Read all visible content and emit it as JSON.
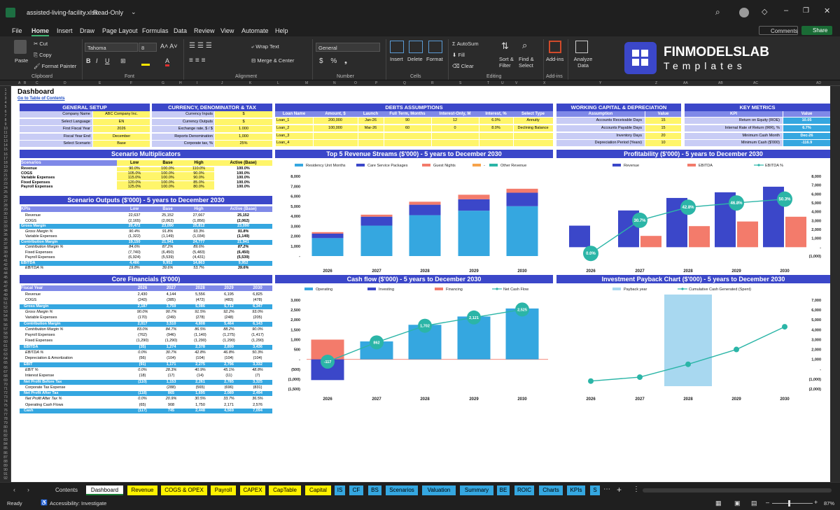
{
  "window": {
    "filename": "assisted-living-facility.xlsx",
    "mode": "Read-Only"
  },
  "menu": [
    "File",
    "Home",
    "Insert",
    "Draw",
    "Page Layout",
    "Formulas",
    "Data",
    "Review",
    "View",
    "Automate",
    "Help"
  ],
  "actions": {
    "comments": "Comments",
    "share": "Share"
  },
  "ribbon": {
    "paste": "Paste",
    "cut": "Cut",
    "copy": "Copy",
    "format_painter": "Format Painter",
    "clipboard": "Clipboard",
    "font_name": "Tahoma",
    "font_size": "8",
    "font": "Font",
    "wrap": "Wrap Text",
    "merge": "Merge & Center",
    "alignment": "Alignment",
    "number_format": "General",
    "number": "Number",
    "insert": "Insert",
    "delete": "Delete",
    "format": "Format",
    "cells": "Cells",
    "autosum": "AutoSum",
    "fill": "Fill",
    "clear": "Clear",
    "sort": "Sort & Filter",
    "find": "Find & Select",
    "editing": "Editing",
    "addins": "Add-ins",
    "analyze": "Analyze Data",
    "addins_group": "Add-ins",
    "brand1": "FINMODELSLAB",
    "brand2": "Templates"
  },
  "columns": [
    "A",
    "B",
    "C",
    "D",
    "E",
    "F",
    "G",
    "H",
    "I",
    "J",
    "K",
    "L",
    "M",
    "N",
    "O",
    "P",
    "Q",
    "R",
    "S",
    "T",
    "U",
    "V",
    "X",
    "Y",
    "Z",
    "AA",
    "AB",
    "AC",
    "AD"
  ],
  "dashboard": {
    "title": "Dashboard",
    "link": "Go to Table of Contents"
  },
  "general": {
    "title": "GENERAL SETUP",
    "rows": [
      [
        "Company Name",
        "ABC Company Inc."
      ],
      [
        "Select Language",
        "EN"
      ],
      [
        "First Fiscal Year",
        "2026"
      ],
      [
        "Fiscal Year End",
        "December"
      ],
      [
        "Select Scenario",
        "Base"
      ]
    ]
  },
  "currency": {
    "title": "CURRENCY, DENOMINATOR & TAX",
    "rows": [
      [
        "Currency Inputs",
        "$"
      ],
      [
        "Currency Outputs",
        "$"
      ],
      [
        "Exchange rate, $ / $",
        "1.000"
      ],
      [
        "Reports Denomination",
        "1,000"
      ],
      [
        "Corporate tax, %",
        "25%"
      ]
    ]
  },
  "debts": {
    "title": "DEBTS ASSUMPTIONS",
    "headers": [
      "Loan Name",
      "Amount, $",
      "Launch",
      "Full Term, Months",
      "Interest-Only, M",
      "Interest, %",
      "Select Type"
    ],
    "rows": [
      [
        "Loan_1",
        "200,000",
        "Jan-26",
        "90",
        "12",
        "6.0%",
        "Annuity"
      ],
      [
        "Loan_2",
        "100,000",
        "Mar-26",
        "60",
        "0",
        "8.0%",
        "Declining Balance"
      ],
      [
        "Loan_3",
        "",
        "",
        "",
        "",
        "",
        ""
      ],
      [
        "Loan_4",
        "",
        "",
        "",
        "",
        "",
        ""
      ]
    ]
  },
  "wc": {
    "title": "WORKING CAPITAL & DEPRECIATION",
    "headers": [
      "Assumption",
      "Value"
    ],
    "rows": [
      [
        "Accounts Receivable Days",
        "15"
      ],
      [
        "Accounts Payable Days",
        "15"
      ],
      [
        "Inventory Days",
        "20"
      ],
      [
        "Depreciation Period (Years)",
        "10"
      ]
    ]
  },
  "km": {
    "title": "KEY METRICS",
    "headers": [
      "KPI",
      "Value"
    ],
    "rows": [
      [
        "Return on Equity (ROE)",
        "10.05"
      ],
      [
        "Internal Rate of Return (IRR), %",
        "6.7%"
      ],
      [
        "Minimum Cash Month",
        "Dec-26"
      ],
      [
        "Minimum Cash ($'000)",
        "-116.9"
      ]
    ]
  },
  "multipliers": {
    "title": "Scenario Multiplicators",
    "headers": [
      "Scenarios",
      "Low",
      "Base",
      "High",
      "Active (Base)"
    ],
    "rows": [
      [
        "Revenue",
        "90.0%",
        "100.0%",
        "110.0%",
        "100.0%"
      ],
      [
        "COGS",
        "105.0%",
        "100.0%",
        "90.0%",
        "100.0%"
      ],
      [
        "Variable Expenses",
        "115.0%",
        "100.0%",
        "90.0%",
        "100.0%"
      ],
      [
        "Fixed Expenses",
        "120.0%",
        "100.0%",
        "85.0%",
        "100.0%"
      ],
      [
        "Payroll Expenses",
        "125.0%",
        "100.0%",
        "80.0%",
        "100.0%"
      ]
    ]
  },
  "outputs": {
    "title": "Scenario Outputs ($'000) - 5 years to December 2030",
    "headers": [
      "KPIs",
      "Low",
      "Base",
      "High",
      "Active (Base)"
    ],
    "rows": [
      [
        "Revenue",
        "22,637",
        "25,152",
        "27,667",
        "25,152",
        "n"
      ],
      [
        "COGS",
        "(2,165)",
        "(2,062)",
        "(1,856)",
        "(2,062)",
        "n"
      ],
      [
        "Gross Margin",
        "20,472",
        "23,090",
        "25,812",
        "23,090",
        "b"
      ],
      [
        "Gross Margin %",
        "90.4%",
        "91.8%",
        "93.3%",
        "91.8%",
        "i"
      ],
      [
        "Variable Expenses",
        "(1,322)",
        "(1,149)",
        "(1,034)",
        "(1,149)",
        "n"
      ],
      [
        "Contribution Margin",
        "19,150",
        "21,941",
        "24,777",
        "21,941",
        "b"
      ],
      [
        "Contribution Margin %",
        "84.6%",
        "87.2%",
        "89.6%",
        "87.2%",
        "i"
      ],
      [
        "Fixed Expenses",
        "(7,740)",
        "(6,450)",
        "(5,483)",
        "(6,450)",
        "n"
      ],
      [
        "Payroll Expenses",
        "(6,924)",
        "(5,539)",
        "(4,431)",
        "(5,539)",
        "n"
      ],
      [
        "EBITDA",
        "4,486",
        "9,952",
        "14,863",
        "9,952",
        "b"
      ],
      [
        "EBITDA %",
        "19.8%",
        "39.6%",
        "53.7%",
        "39.6%",
        "i"
      ]
    ]
  },
  "core": {
    "title": "Core Financials ($'000)",
    "headers": [
      "Fiscal Year",
      "2026",
      "2027",
      "2028",
      "2029",
      "2030"
    ],
    "rows": [
      [
        "Revenue",
        "2,430",
        "4,144",
        "5,556",
        "6,195",
        "6,825",
        "n"
      ],
      [
        "COGS",
        "(243)",
        "(385)",
        "(472)",
        "(483)",
        "(478)",
        "n"
      ],
      [
        "Gross Margin",
        "2,187",
        "3,759",
        "5,086",
        "5,712",
        "6,347",
        "b"
      ],
      [
        "Gross Margin %",
        "90.0%",
        "90.7%",
        "91.5%",
        "92.2%",
        "93.0%",
        "i"
      ],
      [
        "Variable Expenses",
        "(170)",
        "(249)",
        "(278)",
        "(248)",
        "(205)",
        "n"
      ],
      [
        "Contribution Margin",
        "2,017",
        "3,510",
        "4,808",
        "5,464",
        "6,143",
        "b"
      ],
      [
        "Contribution Margin %",
        "83.0%",
        "84.7%",
        "86.5%",
        "88.2%",
        "90.0%",
        "i"
      ],
      [
        "Payroll Expenses",
        "(762)",
        "(946)",
        "(1,140)",
        "(1,275)",
        "(1,417)",
        "n"
      ],
      [
        "Fixed Expenses",
        "(1,290)",
        "(1,290)",
        "(1,290)",
        "(1,290)",
        "(1,290)",
        "n"
      ],
      [
        "EBITDA",
        "(35)",
        "1,274",
        "2,378",
        "2,899",
        "3,436",
        "b"
      ],
      [
        "EBITDA %",
        "0.0%",
        "30.7%",
        "42.8%",
        "46.8%",
        "50.3%",
        "i"
      ],
      [
        "Depreciation & Amortization",
        "(56)",
        "(104)",
        "(104)",
        "(104)",
        "(104)",
        "n"
      ],
      [
        "EBIT",
        "(91)",
        "1,171",
        "2,275",
        "2,796",
        "3,332",
        "b"
      ],
      [
        "EBIT %",
        "0.0%",
        "28.3%",
        "40.9%",
        "45.1%",
        "48.8%",
        "i"
      ],
      [
        "Interest Expense",
        "(18)",
        "(17)",
        "(14)",
        "(11)",
        "(7)",
        "n"
      ],
      [
        "Net Profit Before Tax",
        "(110)",
        "1,153",
        "2,261",
        "2,785",
        "3,325",
        "b"
      ],
      [
        "Corporate Tax Expense",
        "",
        "(288)",
        "(565)",
        "(696)",
        "(831)",
        "n"
      ],
      [
        "Net Profit After Tax",
        "(118)",
        "865",
        "1,695",
        "2,089",
        "2,494",
        "b"
      ],
      [
        "Net Profit After Tax %",
        "0.0%",
        "20.9%",
        "30.5%",
        "33.7%",
        "36.5%",
        "i"
      ],
      [
        "Operating Cash Flows",
        "(65)",
        "908",
        "1,750",
        "2,171",
        "2,576",
        "n"
      ],
      [
        "Cash",
        "(117)",
        "745",
        "2,448",
        "4,569",
        "7,094",
        "b"
      ]
    ]
  },
  "charts": {
    "revenue": {
      "title": "Top 5 Revenue Streams ($'000) - 5 years to December 2030"
    },
    "profit": {
      "title": "Profitability ($'000) - 5 years to December 2030"
    },
    "cash": {
      "title": "Cash flow ($'000) - 5 years to December 2030"
    },
    "payback": {
      "title": "Investment Payback Chart ($'000) - 5 years to December 2030"
    }
  },
  "chart_data": [
    {
      "type": "bar",
      "stacked": true,
      "title": "Top 5 Revenue Streams ($'000) - 5 years to December 2030",
      "categories": [
        "2026",
        "2027",
        "2028",
        "2029",
        "2030"
      ],
      "series": [
        {
          "name": "Residency Unit Months",
          "values": [
            1800,
            3050,
            4100,
            4550,
            5000
          ]
        },
        {
          "name": "Care Service Packages",
          "values": [
            450,
            900,
            1050,
            1150,
            1350
          ]
        },
        {
          "name": "Guest Nights",
          "values": [
            150,
            200,
            300,
            450,
            400
          ]
        },
        {
          "name": "-",
          "values": [
            0,
            0,
            0,
            0,
            0
          ]
        },
        {
          "name": "Other Revenue",
          "values": [
            0,
            0,
            0,
            0,
            0
          ]
        }
      ],
      "ylim": [
        0,
        8000
      ],
      "yticks": [
        "8,000",
        "7,000",
        "6,000",
        "5,000",
        "4,000",
        "3,000",
        "2,000",
        "1,000",
        "-"
      ],
      "colors": [
        "#35a7e0",
        "#3b47c9",
        "#f37b6b",
        "#f6a34b",
        "#2bb5a7"
      ]
    },
    {
      "type": "bar",
      "title": "Profitability ($'000) - 5 years to December 2030",
      "categories": [
        "2026",
        "2027",
        "2028",
        "2029",
        "2030"
      ],
      "series": [
        {
          "name": "Revenue",
          "values": [
            2430,
            4144,
            5556,
            6195,
            6825
          ]
        },
        {
          "name": "EBITDA",
          "values": [
            0,
            1274,
            2378,
            2899,
            3436
          ]
        },
        {
          "name": "EBITDA %",
          "values": [
            0.0,
            30.7,
            42.8,
            46.8,
            50.3
          ],
          "labels": [
            "0.0%",
            "30.7%",
            "42.8%",
            "46.8%",
            "50.3%"
          ]
        }
      ],
      "ylim": [
        -1000,
        8000
      ],
      "yticks": [
        "8,000",
        "7,000",
        "6,000",
        "5,000",
        "4,000",
        "3,000",
        "2,000",
        "1,000",
        "-",
        "(1,000)"
      ],
      "colors": [
        "#3b47c9",
        "#f37b6b",
        "#2bb5a7"
      ]
    },
    {
      "type": "bar",
      "title": "Cash flow ($'000) - 5 years to December 2030",
      "categories": [
        "2026",
        "2027",
        "2028",
        "2029",
        "2030"
      ],
      "series": [
        {
          "name": "Operating",
          "values": [
            0,
            908,
            1750,
            2171,
            2576
          ]
        },
        {
          "name": "Investing",
          "values": [
            -1050,
            0,
            0,
            0,
            0
          ]
        },
        {
          "name": "Financing",
          "values": [
            1000,
            0,
            0,
            0,
            0
          ]
        },
        {
          "name": "Net Cash Flow",
          "values": [
            -117,
            862,
            1702,
            2121,
            2525
          ],
          "labels": [
            "-117",
            "862",
            "1,702",
            "2,121",
            "2,525"
          ]
        }
      ],
      "ylim": [
        -1500,
        3000
      ],
      "yticks": [
        "3,000",
        "2,500",
        "2,000",
        "1,500",
        "1,000",
        "500",
        "-",
        "(500)",
        "(1,000)",
        "(1,500)"
      ],
      "colors": [
        "#35a7e0",
        "#3b47c9",
        "#f37b6b",
        "#2bb5a7"
      ]
    },
    {
      "type": "line",
      "title": "Investment Payback Chart ($'000) - 5 years to December 2030",
      "categories": [
        "2026",
        "2027",
        "2028",
        "2029",
        "2030"
      ],
      "series": [
        {
          "name": "Payback year",
          "values": [
            0,
            0,
            1,
            0,
            0
          ]
        },
        {
          "name": "Cumulative Cash Generated (Spent)",
          "values": [
            -1200,
            -800,
            500,
            2000,
            4300
          ]
        }
      ],
      "ylim": [
        -2000,
        7000
      ],
      "yticks": [
        "7,000",
        "6,000",
        "5,000",
        "4,000",
        "3,000",
        "2,000",
        "1,000",
        "-",
        "(1,000)",
        "(2,000)"
      ],
      "colors": [
        "#a8d8f0",
        "#2bb5a7"
      ]
    }
  ],
  "tabs": [
    {
      "label": "Contents",
      "style": "plain"
    },
    {
      "label": "Dashboard",
      "style": "active"
    },
    {
      "label": "Revenue",
      "style": "yellow"
    },
    {
      "label": "COGS & OPEX",
      "style": "yellow"
    },
    {
      "label": "Payroll",
      "style": "yellow"
    },
    {
      "label": "CAPEX",
      "style": "yellow"
    },
    {
      "label": "CapTable",
      "style": "yellow"
    },
    {
      "label": "Capital",
      "style": "yellow"
    },
    {
      "label": "IS",
      "style": "blue"
    },
    {
      "label": "CF",
      "style": "blue"
    },
    {
      "label": "BS",
      "style": "blue"
    },
    {
      "label": "Scenarios",
      "style": "blue"
    },
    {
      "label": "Valuation",
      "style": "blue"
    },
    {
      "label": "Summary",
      "style": "blue"
    },
    {
      "label": "BE",
      "style": "blue"
    },
    {
      "label": "ROIC",
      "style": "blue"
    },
    {
      "label": "Charts",
      "style": "blue"
    },
    {
      "label": "KPIs",
      "style": "blue"
    },
    {
      "label": "S",
      "style": "blue"
    }
  ],
  "status": {
    "ready": "Ready",
    "accessibility": "Accessibility: Investigate",
    "zoom": "87%"
  }
}
